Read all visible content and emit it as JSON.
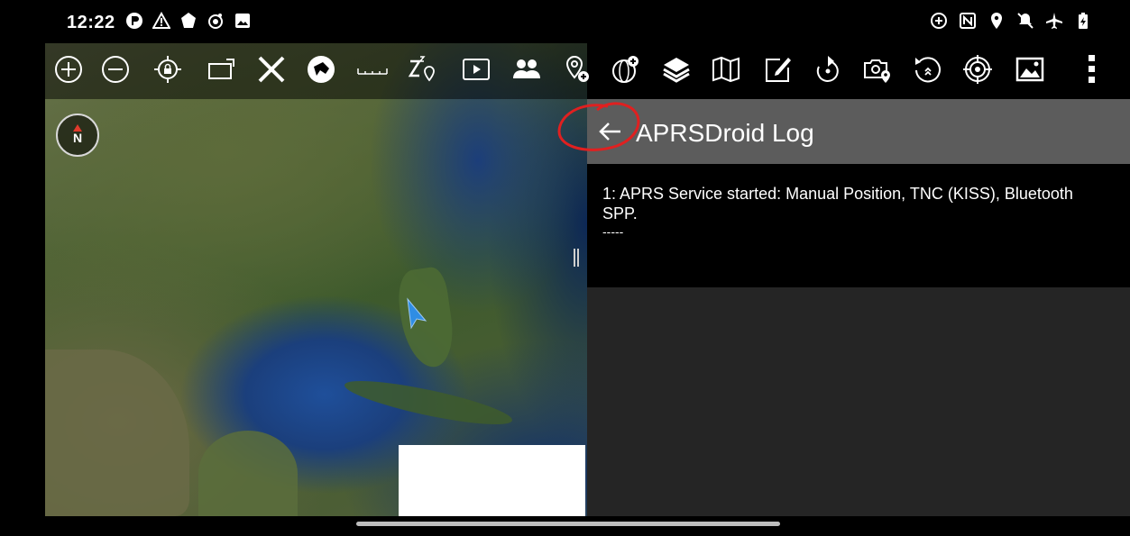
{
  "status_bar": {
    "time": "12:22",
    "left_icons": [
      "app-notification-icon",
      "warning-icon",
      "shield-notification-icon",
      "nfc-signal-icon",
      "image-notification-icon"
    ],
    "right_icons": [
      "data-saver-icon",
      "nfc-icon",
      "location-icon",
      "do-not-disturb-icon",
      "airplane-mode-icon",
      "battery-charging-icon"
    ]
  },
  "toolbar": {
    "icons": [
      "zoom-in-icon",
      "zoom-out-icon",
      "lock-position-icon",
      "frame-icon",
      "close-x-icon",
      "dog-head-icon",
      "scale-ruler-icon",
      "zzz-location-icon",
      "play-icon",
      "people-icon",
      "add-location-icon",
      "add-globe-icon",
      "layers-icon",
      "map-icon",
      "edit-icon",
      "track-icon",
      "camera-location-icon",
      "rewind-icon",
      "target-icon",
      "image-icon",
      "overflow-menu-icon"
    ]
  },
  "map": {
    "compass_label": "N"
  },
  "log_panel": {
    "title": "APRSDroid Log",
    "entries": [
      {
        "text": "1: APRS Service started: Manual Position, TNC (KISS), Bluetooth SPP.",
        "separator": "-----"
      }
    ]
  },
  "colors": {
    "header": "#5c5c5c",
    "panel_bg": "#252525",
    "log_bg": "#000000",
    "annotation": "#e02020"
  }
}
